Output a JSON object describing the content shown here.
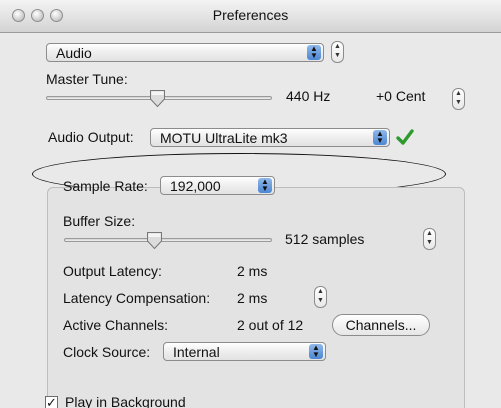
{
  "window": {
    "title": "Preferences"
  },
  "category": {
    "selected": "Audio"
  },
  "master_tune": {
    "label": "Master Tune:",
    "frequency": "440 Hz",
    "cent": "+0 Cent",
    "slider_level": 0.5
  },
  "audio_output": {
    "label": "Audio Output:",
    "selected": "MOTU UltraLite mk3",
    "status_icon": "checkmark-icon",
    "status_color": "#2e9a2e"
  },
  "sample_rate": {
    "label": "Sample Rate:",
    "selected": "192,000"
  },
  "buffer_size": {
    "label": "Buffer Size:",
    "value": "512 samples",
    "slider_level": 0.5
  },
  "output_latency": {
    "label": "Output Latency:",
    "value": "2 ms"
  },
  "latency_compensation": {
    "label": "Latency Compensation:",
    "value": "2 ms"
  },
  "active_channels": {
    "label": "Active Channels:",
    "value": "2 out of 12",
    "button_label": "Channels..."
  },
  "clock_source": {
    "label": "Clock Source:",
    "selected": "Internal"
  },
  "play_in_background": {
    "label": "Play in Background",
    "checked": true
  }
}
